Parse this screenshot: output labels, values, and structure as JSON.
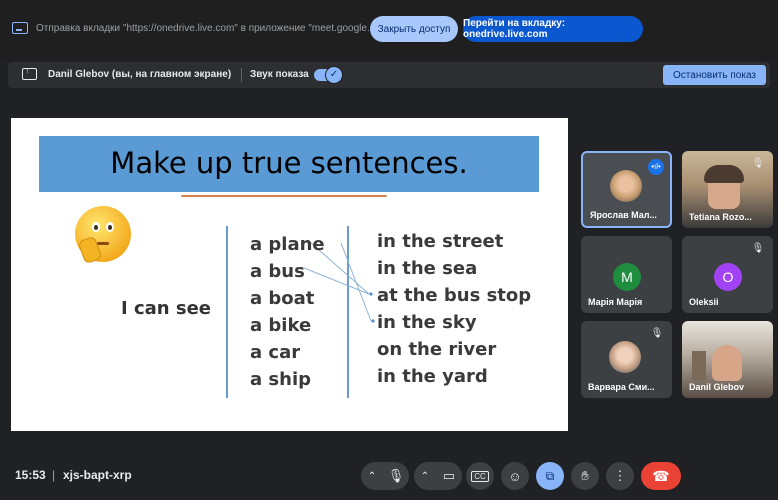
{
  "share_bar": {
    "message": "Отправка вкладки \"https://onedrive.live.com\" в приложение \"meet.google.com\"...",
    "stop_access_label": "Закрыть доступ",
    "switch_tab_label": "Перейти на вкладку: onedrive.live.com"
  },
  "presenter_bar": {
    "presenter_name": "Danil Glebov (вы, на главном экране)",
    "separator": "|",
    "sound_label": "Звук показа",
    "sound_on": true,
    "stop_show_label": "Остановить показ"
  },
  "slide": {
    "title": "Make up true sentences.",
    "subject": "I can see",
    "vehicles": [
      "a plane",
      "a bus",
      "a boat",
      "a bike",
      "a car",
      "a ship"
    ],
    "places": [
      "in the street",
      "in the sea",
      "at the bus stop",
      "in the sky",
      "on the river",
      "in the yard"
    ],
    "title_band_color": "#5b9bd5"
  },
  "participants": [
    {
      "name": "Ярослав Мал...",
      "speaking": true,
      "avatar": "photo"
    },
    {
      "name": "Tetiana Rozo...",
      "muted": true,
      "avatar": "video"
    },
    {
      "name": "Марія Марія",
      "avatar_letter": "M",
      "avatar_color": "#1e8e3e"
    },
    {
      "name": "Oleksii",
      "muted": true,
      "avatar_letter": "O",
      "avatar_color": "#a142f4"
    },
    {
      "name": "Варвара Сми...",
      "muted": true,
      "avatar": "photo"
    },
    {
      "name": "Danil Glebov",
      "avatar": "video"
    }
  ],
  "toolbar": {
    "time": "15:53",
    "separator": "|",
    "meeting_code": "xjs-bapt-xrp",
    "end_call_color": "#ea4335",
    "present_active_color": "#8ab4f8"
  }
}
